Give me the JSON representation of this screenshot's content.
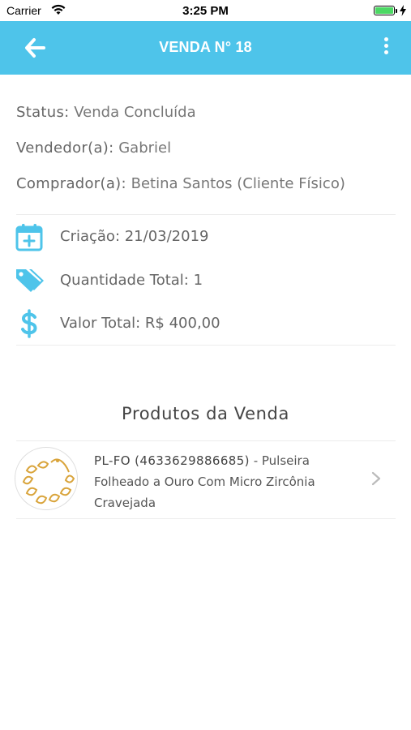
{
  "status_bar": {
    "carrier": "Carrier",
    "time": "3:25 PM"
  },
  "app_bar": {
    "title": "VENDA N° 18",
    "color": "#4ec4ea"
  },
  "sale": {
    "status_label": "Status:",
    "status_value": "Venda Concluída",
    "seller_label": "Vendedor(a):",
    "seller_value": "Gabriel",
    "buyer_label": "Comprador(a):",
    "buyer_value": "Betina Santos (Cliente Físico)"
  },
  "details": {
    "created": "Criação: 21/03/2019",
    "quantity": "Quantidade Total: 1",
    "total": "Valor Total: R$ 400,00",
    "icon_color": "#4ec4ea"
  },
  "products_section": {
    "title": "Produtos da Venda",
    "items": [
      {
        "code": "PL-FO (4633629886685)",
        "name_line1": " - Pulseira",
        "name_line2": "Folheado a Ouro Com Micro Zircônia",
        "name_line3": "Cravejada",
        "thumbnail_icon": "gold-bracelet"
      }
    ]
  }
}
